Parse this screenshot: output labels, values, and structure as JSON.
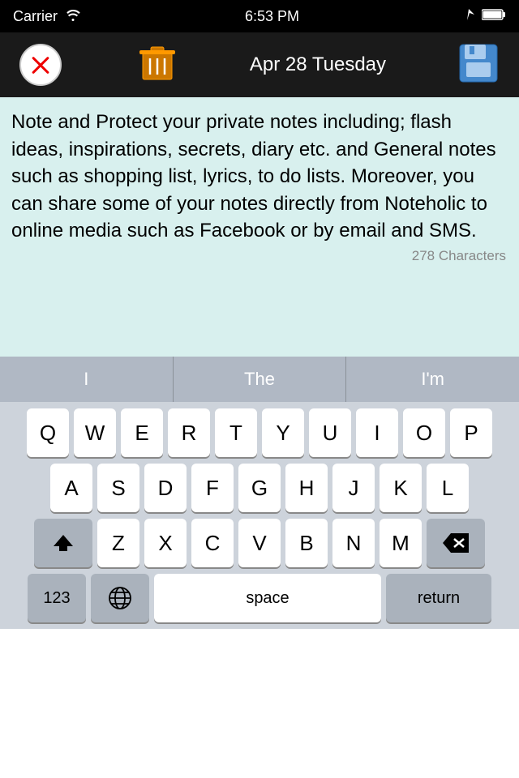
{
  "statusBar": {
    "carrier": "Carrier",
    "time": "6:53 PM"
  },
  "toolbar": {
    "date": "Apr 28 Tuesday"
  },
  "noteArea": {
    "text": "Note and Protect your private notes including; flash ideas, inspirations, secrets, diary etc. and General notes such as shopping list, lyrics, to do lists. Moreover, you can share some of your notes directly from Noteholic to online media such as Facebook or by email and SMS.",
    "charCount": "278 Characters"
  },
  "autocomplete": {
    "item1": "I",
    "item2": "The",
    "item3": "I'm"
  },
  "keyboard": {
    "row1": [
      "Q",
      "W",
      "E",
      "R",
      "T",
      "Y",
      "U",
      "I",
      "O",
      "P"
    ],
    "row2": [
      "A",
      "S",
      "D",
      "F",
      "G",
      "H",
      "J",
      "K",
      "L"
    ],
    "row3": [
      "Z",
      "X",
      "C",
      "V",
      "B",
      "N",
      "M"
    ],
    "bottomLabels": {
      "numbers": "123",
      "space": "space",
      "return": "return"
    }
  }
}
